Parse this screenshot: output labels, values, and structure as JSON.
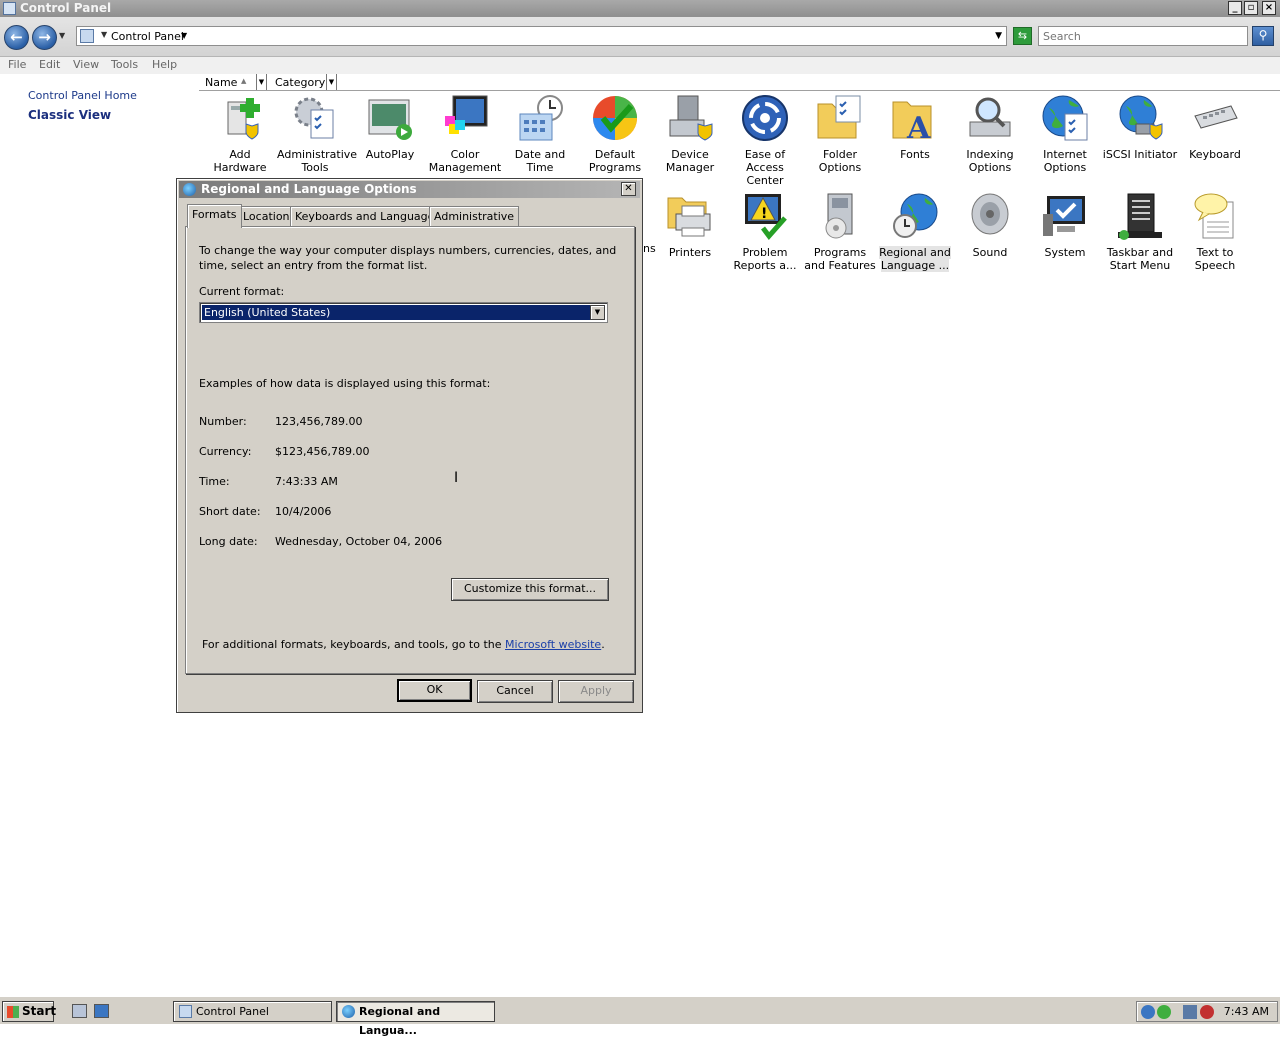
{
  "window": {
    "title": "Control Panel"
  },
  "address": {
    "crumb": "Control Panel",
    "search_placeholder": "Search"
  },
  "menu": [
    "File",
    "Edit",
    "View",
    "Tools",
    "Help"
  ],
  "left_pane": {
    "home_link": "Control Panel Home",
    "classic_view": "Classic View"
  },
  "columns": {
    "name": "Name",
    "category": "Category"
  },
  "items_row1": [
    {
      "label": "Add Hardware",
      "icon": "add-hardware-icon"
    },
    {
      "label": "Administrative Tools",
      "icon": "administrative-tools-icon"
    },
    {
      "label": "AutoPlay",
      "icon": "autoplay-icon"
    },
    {
      "label": "Color Management",
      "icon": "color-management-icon"
    },
    {
      "label": "Date and Time",
      "icon": "date-time-icon"
    },
    {
      "label": "Default Programs",
      "icon": "default-programs-icon"
    },
    {
      "label": "Device Manager",
      "icon": "device-manager-icon"
    },
    {
      "label": "Ease of Access Center",
      "icon": "ease-of-access-icon"
    },
    {
      "label": "Folder Options",
      "icon": "folder-options-icon"
    },
    {
      "label": "Fonts",
      "icon": "fonts-icon"
    },
    {
      "label": "Indexing Options",
      "icon": "indexing-options-icon"
    },
    {
      "label": "Internet Options",
      "icon": "internet-options-icon"
    },
    {
      "label": "iSCSI Initiator",
      "icon": "iscsi-initiator-icon"
    },
    {
      "label": "Keyboard",
      "icon": "keyboard-icon"
    }
  ],
  "items_row2_partial": "ns",
  "items_row2": [
    {
      "label": "Printers",
      "icon": "printers-icon"
    },
    {
      "label": "Problem Reports a...",
      "icon": "problem-reports-icon"
    },
    {
      "label": "Programs and Features",
      "icon": "programs-features-icon"
    },
    {
      "label": "Regional and Language ...",
      "icon": "regional-language-icon"
    },
    {
      "label": "Sound",
      "icon": "sound-icon"
    },
    {
      "label": "System",
      "icon": "system-icon"
    },
    {
      "label": "Taskbar and Start Menu",
      "icon": "taskbar-start-menu-icon"
    },
    {
      "label": "Text to Speech",
      "icon": "text-to-speech-icon"
    }
  ],
  "dialog": {
    "title": "Regional and Language Options",
    "tabs": [
      "Formats",
      "Location",
      "Keyboards and Languages",
      "Administrative"
    ],
    "intro": "To change the way your computer displays numbers, currencies, dates, and time, select an entry from the format list.",
    "current_format_label": "Current format:",
    "current_format": "English (United States)",
    "examples_label": "Examples of how data is displayed using this format:",
    "examples": [
      {
        "label": "Number:",
        "value": "123,456,789.00"
      },
      {
        "label": "Currency:",
        "value": "$123,456,789.00"
      },
      {
        "label": "Time:",
        "value": "7:43:33 AM"
      },
      {
        "label": "Short date:",
        "value": "10/4/2006"
      },
      {
        "label": "Long date:",
        "value": "Wednesday, October 04, 2006"
      }
    ],
    "customize_button": "Customize this format...",
    "footer_text": "For additional formats, keyboards, and tools, go to the",
    "footer_link": "Microsoft website",
    "footer_end": ".",
    "ok": "OK",
    "cancel": "Cancel",
    "apply": "Apply"
  },
  "taskbar": {
    "start": "Start",
    "tasks": [
      "Control Panel",
      "Regional and Langua..."
    ],
    "clock": "7:43 AM"
  }
}
